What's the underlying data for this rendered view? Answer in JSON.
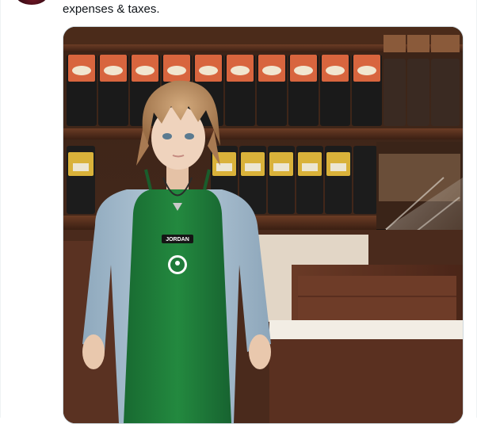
{
  "tweet": {
    "text": "expenses & taxes.",
    "media": {
      "name_tag": "JORDAN"
    }
  },
  "colors": {
    "text": "#0f1419",
    "apron": "#1f7a3a",
    "shirt": "#a9c1d3",
    "hair": "#b88a5e",
    "counter_wood": "#5a2e1f",
    "media_border": "#cfd9de"
  }
}
